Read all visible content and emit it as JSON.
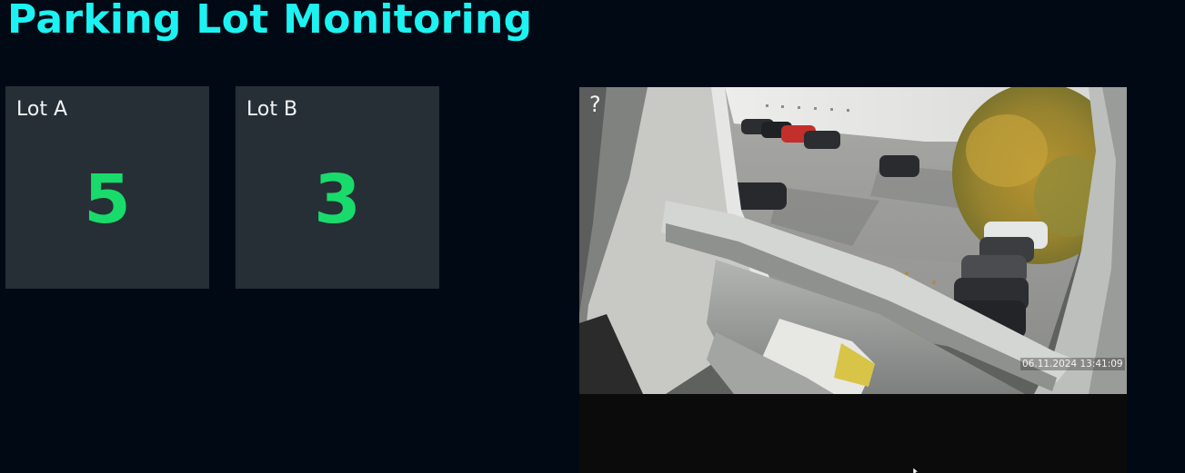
{
  "header": {
    "title": "Parking Lot Monitoring"
  },
  "lots": [
    {
      "label": "Lot A",
      "count": "5"
    },
    {
      "label": "Lot B",
      "count": "3"
    }
  ],
  "camera": {
    "help_icon": "?",
    "timestamp": "06.11.2024 13:41:09",
    "help_icon_name": "help-icon",
    "cursor_icon_name": "mouse-cursor-icon"
  },
  "colors": {
    "background": "#010a14",
    "title": "#1df2f2",
    "tile_background": "#262f36",
    "tile_label": "#f1f4f6",
    "count": "#19db6b"
  }
}
